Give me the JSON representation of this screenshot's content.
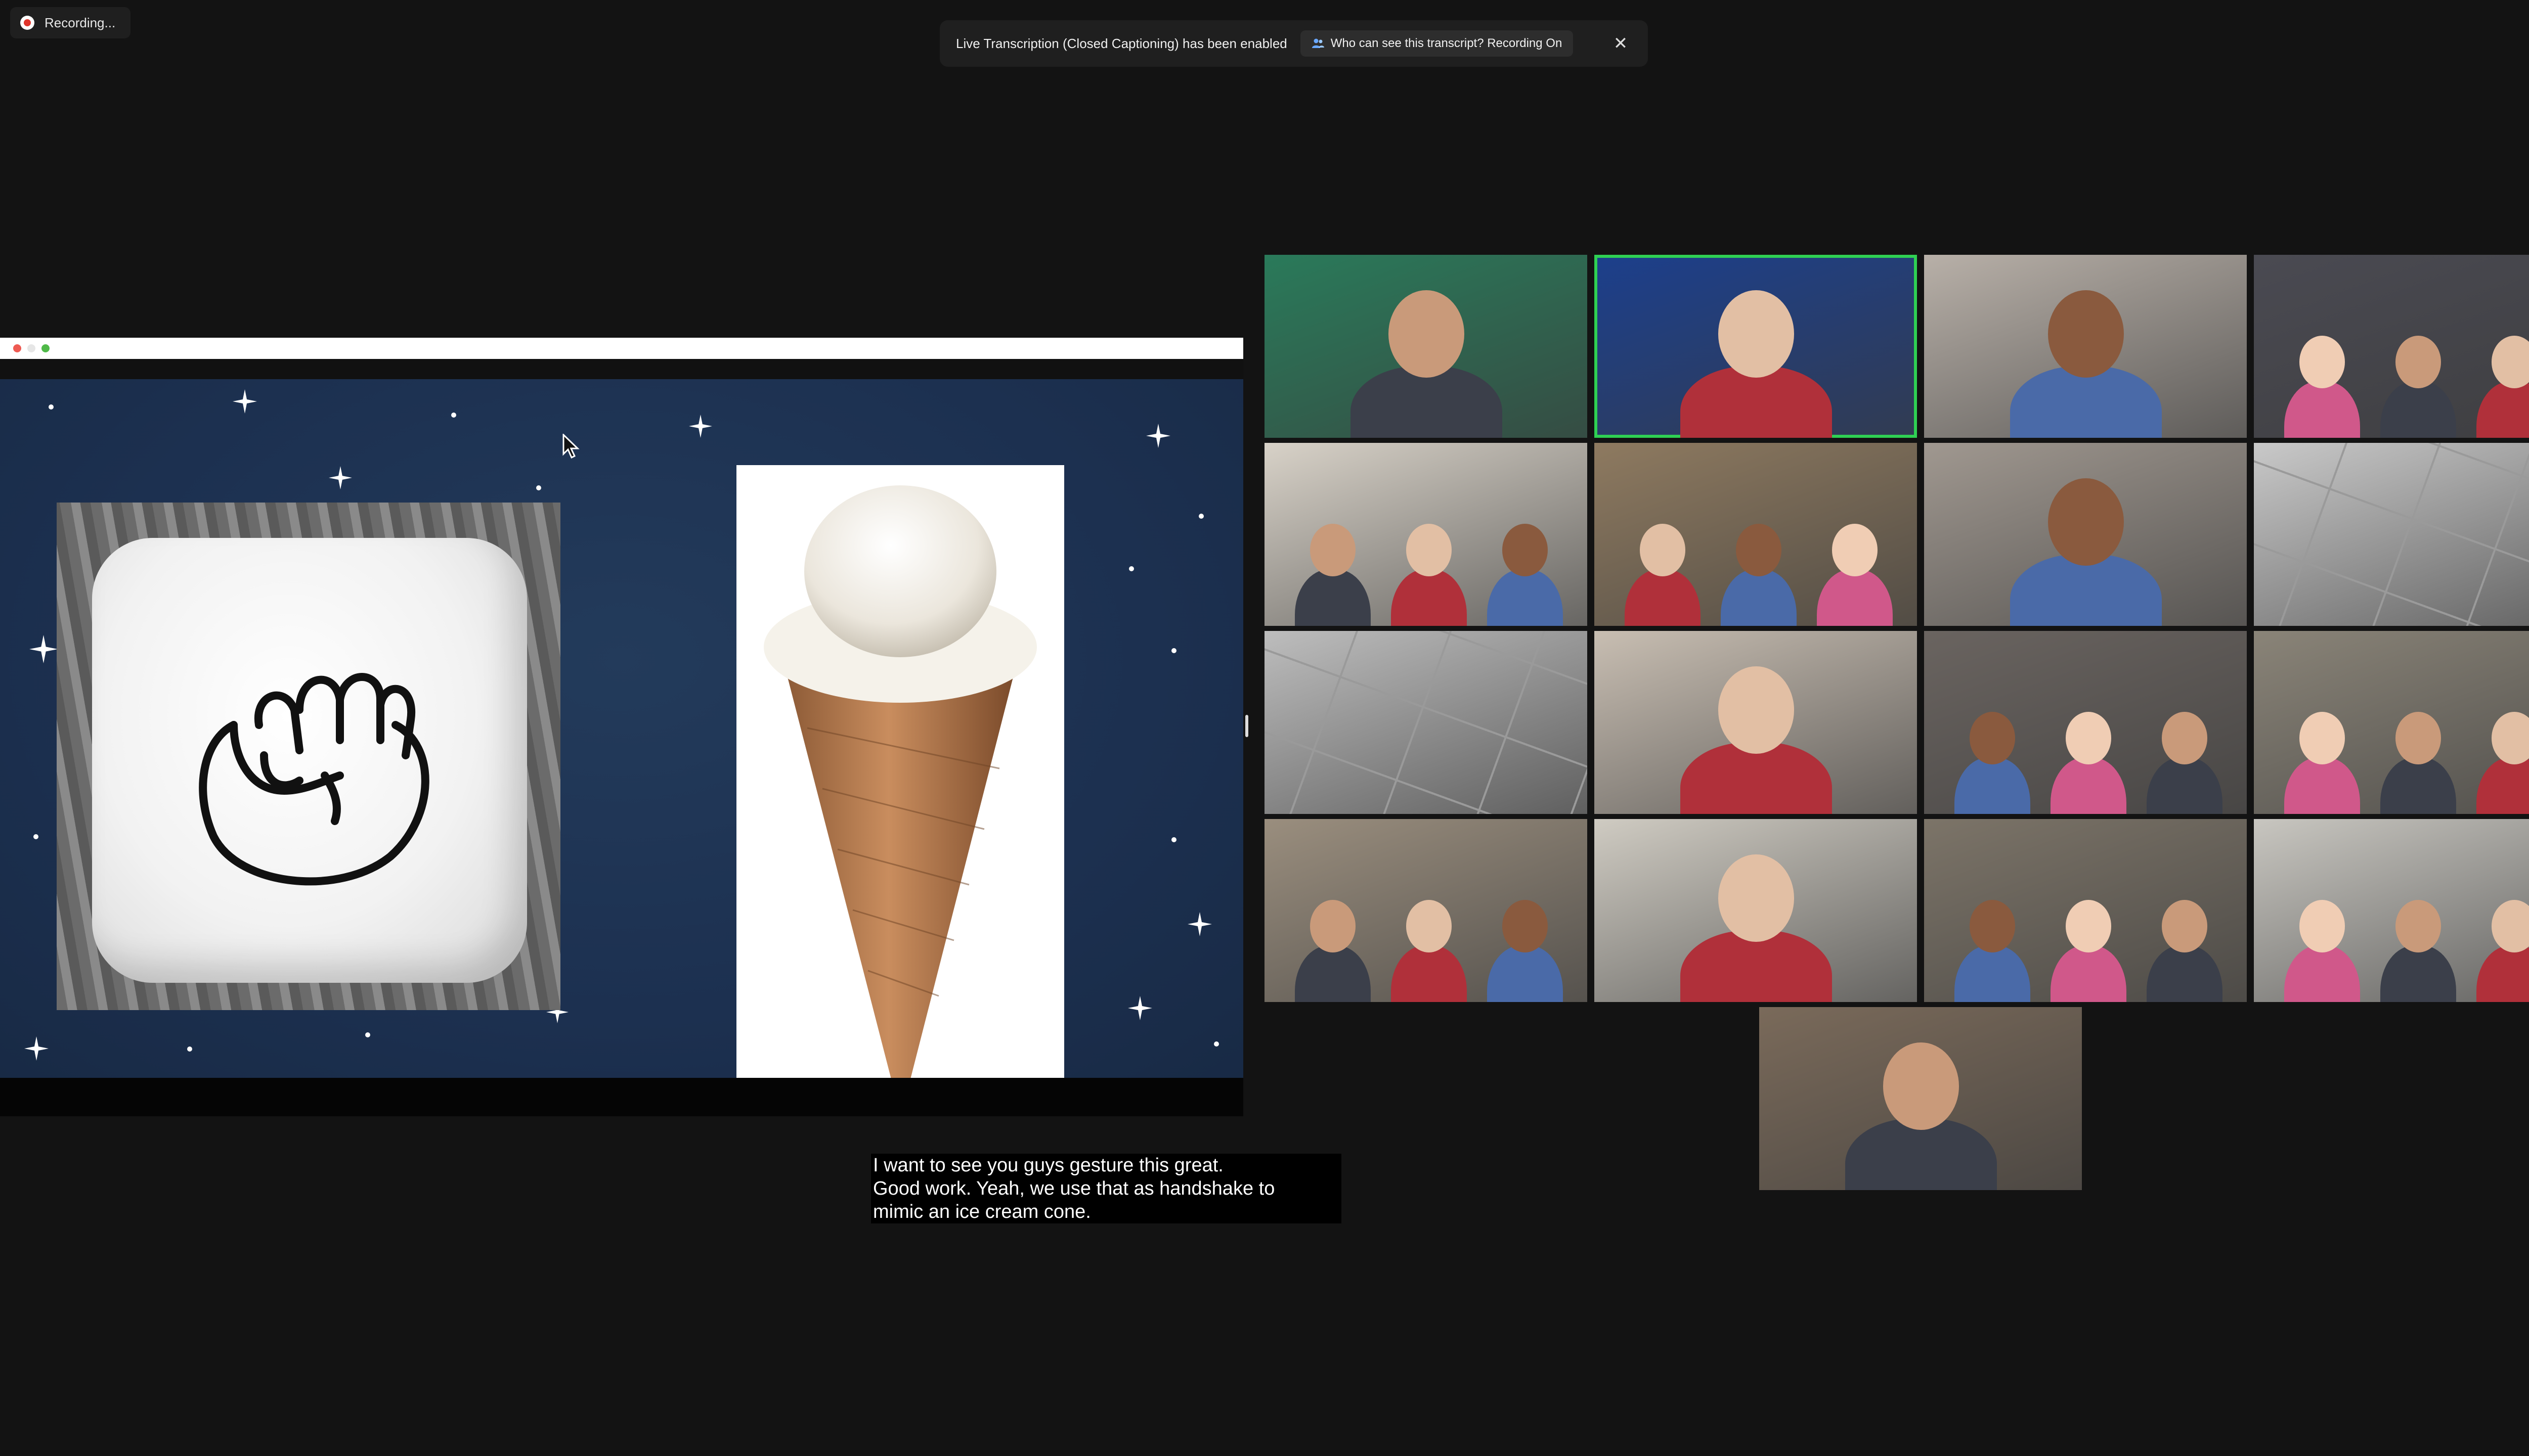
{
  "recording": {
    "label": "Recording..."
  },
  "banner": {
    "message": "Live Transcription (Closed Captioning) has been enabled",
    "link": "Who can see this transcript? Recording On"
  },
  "transcript": {
    "lines": [
      "I want to see you guys gesture this great.",
      "Good work. Yeah, we use that as handshake to",
      "mimic an ice cream cone."
    ]
  },
  "participants": [
    {
      "role": "interpreter",
      "bg": "#2a7a5a"
    },
    {
      "role": "teacher-active-speaker",
      "bg": "#1c3f8c"
    },
    {
      "role": "student",
      "bg": "#b8b0a8"
    },
    {
      "role": "students",
      "bg": "#4a4a52"
    },
    {
      "role": "students",
      "bg": "#d8d2c8"
    },
    {
      "role": "students",
      "bg": "#8e7a60"
    },
    {
      "role": "student",
      "bg": "#a09890"
    },
    {
      "role": "ceiling",
      "bg": "#c9c9c9"
    },
    {
      "role": "ceiling",
      "bg": "#bdbdbd"
    },
    {
      "role": "student",
      "bg": "#c8beb2"
    },
    {
      "role": "students",
      "bg": "#6a6460"
    },
    {
      "role": "classroom",
      "bg": "#8a8478"
    },
    {
      "role": "classroom",
      "bg": "#9a8e7e"
    },
    {
      "role": "student",
      "bg": "#cfcbc2"
    },
    {
      "role": "classroom",
      "bg": "#7c7468"
    },
    {
      "role": "classroom",
      "bg": "#c8c6c0"
    },
    {
      "role": "student",
      "bg": "#7a6a5a"
    }
  ]
}
